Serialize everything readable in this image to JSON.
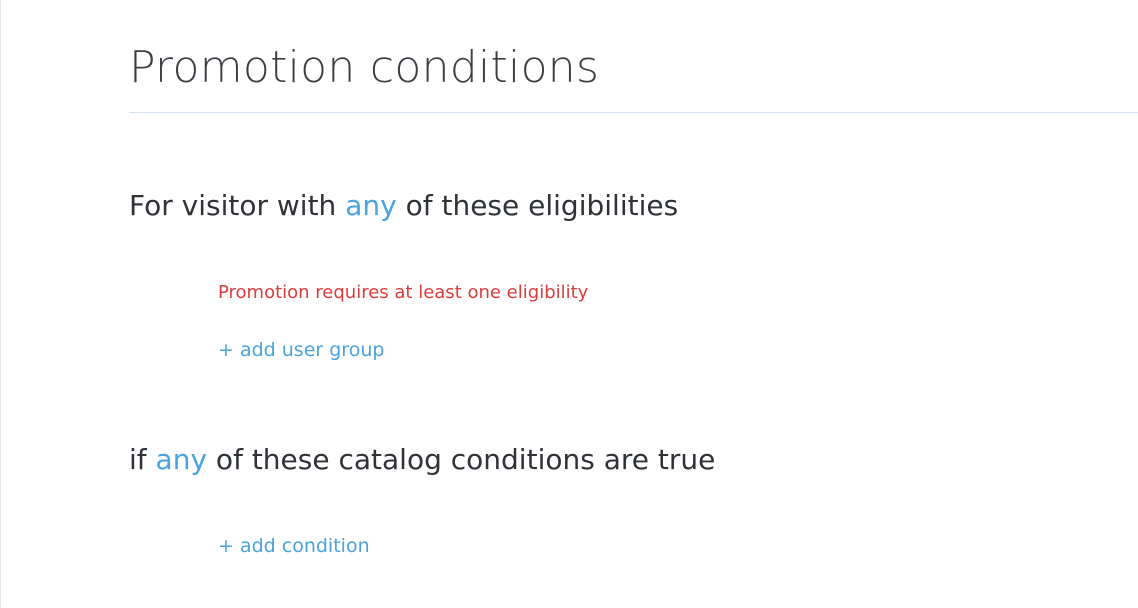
{
  "page": {
    "title": "Promotion conditions"
  },
  "eligibility_section": {
    "prefix": "For visitor with ",
    "match_mode": "any",
    "suffix": " of these eligibilities",
    "error_message": "Promotion requires at least one eligibility",
    "add_label": "+ add user group"
  },
  "catalog_section": {
    "prefix": "if ",
    "match_mode": "any",
    "suffix": " of these catalog conditions are true",
    "add_label": "+ add condition"
  },
  "colors": {
    "accent": "#4aa3df",
    "error": "#e03b3b",
    "heading_text": "#2f3338",
    "divider": "#d6e2ee"
  }
}
